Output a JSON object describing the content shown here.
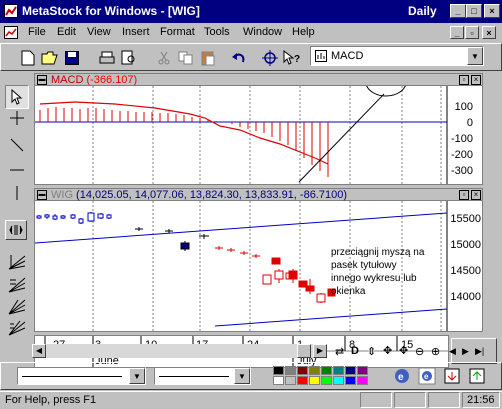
{
  "window": {
    "title": "MetaStock for Windows - [WIG]",
    "period": "Daily"
  },
  "menu": [
    "File",
    "Edit",
    "View",
    "Insert",
    "Format",
    "Tools",
    "Window",
    "Help"
  ],
  "toolbar": {
    "indicator_value": "MACD"
  },
  "macd_panel": {
    "title": "MACD",
    "value": "(-366.107)",
    "ticks": [
      "100",
      "0",
      "-100",
      "-200",
      "-300"
    ]
  },
  "wig_panel": {
    "title": "WIG",
    "ohlc": " (14,025.05, 14,077.06, 13,824.30, 13,833.91, -86.7100)",
    "ticks": [
      "15500",
      "15000",
      "14500",
      "14000"
    ],
    "annotation": [
      "przeciągnij myszą na",
      "pasek tytułowy",
      "innego wykresu lub",
      "okienka"
    ]
  },
  "date_axis": {
    "days": [
      "27",
      "3",
      "10",
      "17",
      "24",
      "1",
      "8",
      "15"
    ],
    "months": [
      "June",
      "July"
    ]
  },
  "status": {
    "help": "For Help, press F1",
    "time": "21:56"
  },
  "palette": [
    "#000000",
    "#808080",
    "#800000",
    "#808000",
    "#008000",
    "#008080",
    "#000080",
    "#800080",
    "#ffffff",
    "#c0c0c0",
    "#ff0000",
    "#ffff00",
    "#00ff00",
    "#00ffff",
    "#0000ff",
    "#ff00ff"
  ]
}
